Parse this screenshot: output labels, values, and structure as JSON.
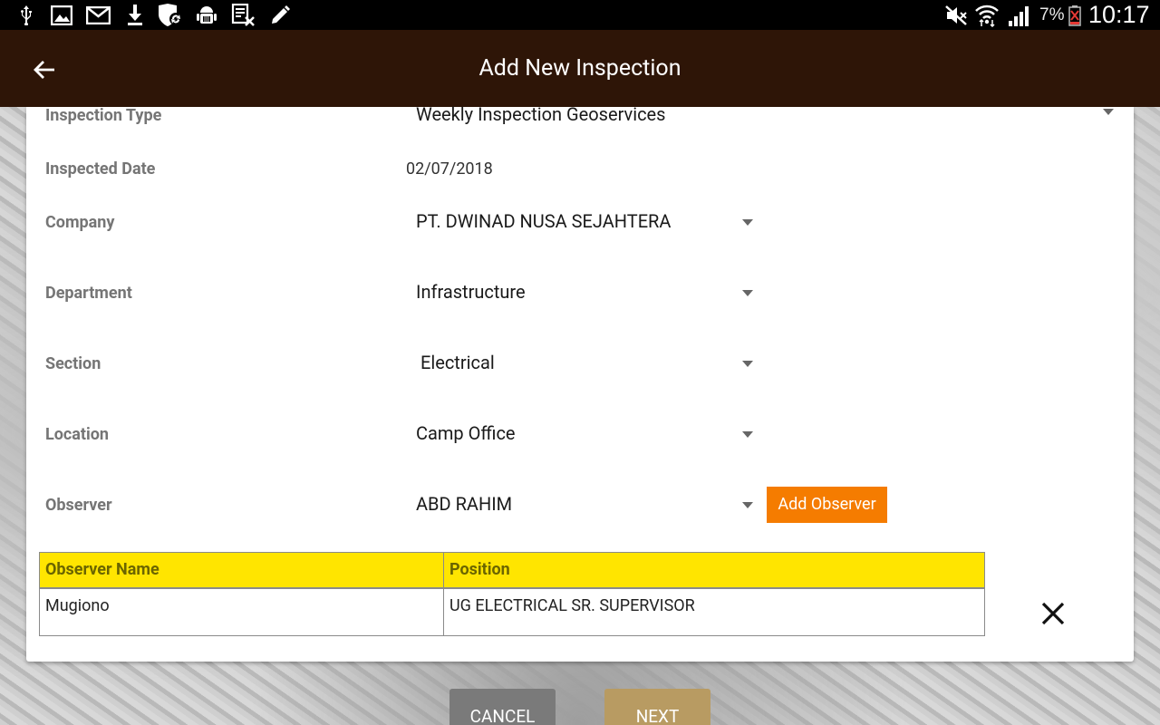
{
  "status_bar": {
    "left_icons": [
      "usb-icon",
      "image-icon",
      "gmail-icon",
      "download-icon",
      "shield-sync-icon",
      "android-debug-icon",
      "document-x-icon",
      "pencil-icon"
    ],
    "right_icons": [
      "mute-icon",
      "wifi-icon",
      "signal-icon",
      "battery-icon"
    ],
    "battery_text": "7%",
    "time": "10:17"
  },
  "app_bar": {
    "title": "Add New Inspection",
    "back_icon": "arrow-back-icon",
    "color": "#2e1507"
  },
  "form": {
    "inspection_type": {
      "label": "Inspection Type",
      "value": "Weekly Inspection Geoservices"
    },
    "inspected_date": {
      "label": "Inspected Date",
      "value": "02/07/2018"
    },
    "company": {
      "label": "Company",
      "value": "PT. DWINAD NUSA SEJAHTERA"
    },
    "department": {
      "label": "Department",
      "value": "Infrastructure"
    },
    "section": {
      "label": "Section",
      "value": "Electrical"
    },
    "location": {
      "label": "Location",
      "value": "Camp Office"
    },
    "observer": {
      "label": "Observer",
      "value": "ABD RAHIM",
      "add_button": "Add Observer"
    }
  },
  "observer_table": {
    "headers": [
      "Observer Name",
      "Position"
    ],
    "rows": [
      {
        "name": "Mugiono",
        "position": "UG ELECTRICAL SR. SUPERVISOR"
      }
    ],
    "header_color": "#ffe500"
  },
  "footer": {
    "cancel_label": "CANCEL",
    "next_label": "NEXT"
  },
  "colors": {
    "accent_orange": "#f57c00",
    "next_button": "#b89b62",
    "cancel_button": "#7a7a7a"
  }
}
